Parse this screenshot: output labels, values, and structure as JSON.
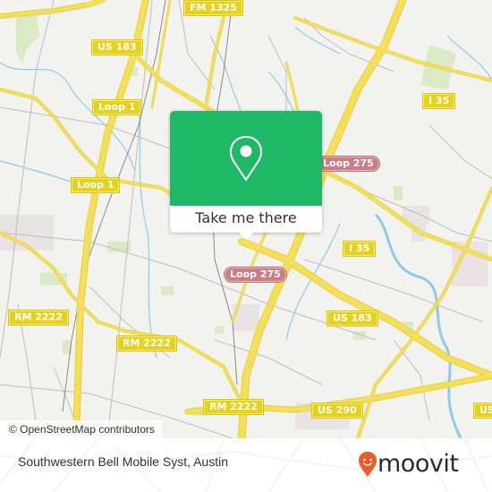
{
  "map": {
    "road_shields": [
      {
        "id": "fm-1325",
        "label": "FM 1325",
        "type": "farm-to-market"
      },
      {
        "id": "us-183-north",
        "label": "US 183",
        "type": "us-highway"
      },
      {
        "id": "loop-1-north",
        "label": "Loop 1",
        "type": "state-loop"
      },
      {
        "id": "loop-1-west",
        "label": "Loop 1",
        "type": "state-loop"
      },
      {
        "id": "i-35-north",
        "label": "I 35",
        "type": "interstate"
      },
      {
        "id": "loop-275-east",
        "label": "Loop 275",
        "type": "loop-275"
      },
      {
        "id": "loop-275-south",
        "label": "Loop 275",
        "type": "loop-275"
      },
      {
        "id": "i-35-south",
        "label": "I 35",
        "type": "interstate"
      },
      {
        "id": "rm-2222-west",
        "label": "RM 2222",
        "type": "ranch-to-market"
      },
      {
        "id": "rm-2222-center",
        "label": "RM 2222",
        "type": "ranch-to-market"
      },
      {
        "id": "rm-2222-south",
        "label": "RM 2222",
        "type": "ranch-to-market"
      },
      {
        "id": "us-183-south",
        "label": "US 183",
        "type": "us-highway"
      },
      {
        "id": "us-290",
        "label": "US 290",
        "type": "us-highway"
      },
      {
        "id": "us-edge",
        "label": "US",
        "type": "us-highway"
      }
    ],
    "popup": {
      "icon": "map-pin-icon",
      "button_label": "Take me there",
      "color": "#1fb866"
    },
    "attribution": "© OpenStreetMap contributors",
    "colors": {
      "background": "#f2f2ef",
      "highway": "#f4dd5a",
      "minor_road": "#b8b8b8",
      "water": "#8fcbe8",
      "park": "#d6e9c0"
    }
  },
  "footer": {
    "place_name": "Southwestern Bell Mobile Syst, Austin",
    "brand": "moovit",
    "brand_color": "#f05a28"
  }
}
